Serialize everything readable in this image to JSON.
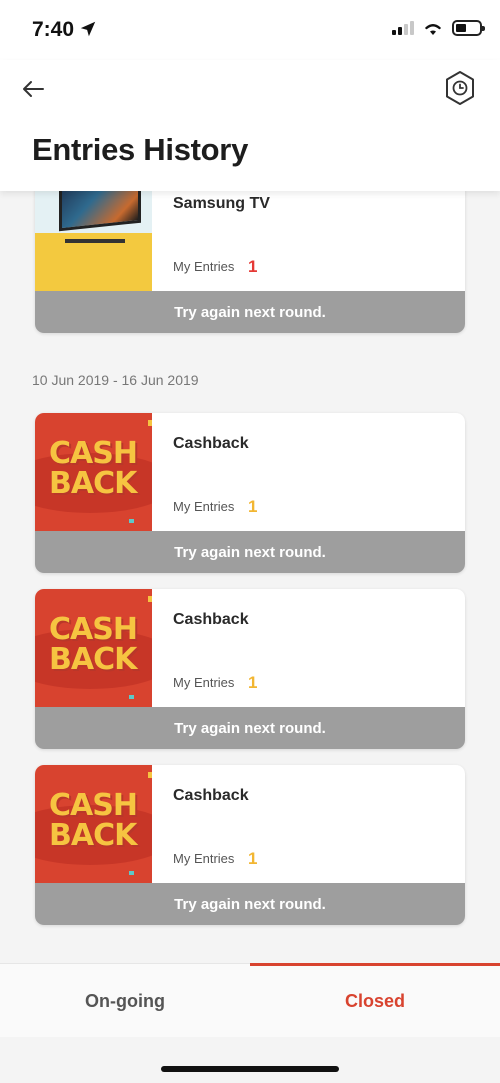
{
  "status_bar": {
    "time": "7:40"
  },
  "header": {
    "title": "Entries History"
  },
  "groups": [
    {
      "date_range": "",
      "cards": [
        {
          "title": "Samsung TV",
          "entries_label": "My Entries",
          "entries_count": "1",
          "count_color": "#e53935",
          "status": "Try again next round.",
          "image": "samsung-tv"
        }
      ]
    },
    {
      "date_range": "10 Jun 2019 - 16 Jun 2019",
      "cards": [
        {
          "title": "Cashback",
          "entries_label": "My Entries",
          "entries_count": "1",
          "count_color": "#f2b632",
          "status": "Try again next round.",
          "image": "cashback",
          "image_text": [
            "CASH",
            "BACK"
          ]
        },
        {
          "title": "Cashback",
          "entries_label": "My Entries",
          "entries_count": "1",
          "count_color": "#f2b632",
          "status": "Try again next round.",
          "image": "cashback",
          "image_text": [
            "CASH",
            "BACK"
          ]
        },
        {
          "title": "Cashback",
          "entries_label": "My Entries",
          "entries_count": "1",
          "count_color": "#f2b632",
          "status": "Try again next round.",
          "image": "cashback",
          "image_text": [
            "CASH",
            "BACK"
          ]
        }
      ]
    }
  ],
  "tabs": [
    {
      "label": "On-going",
      "active": false
    },
    {
      "label": "Closed",
      "active": true
    }
  ],
  "colors": {
    "accent": "#d8432f",
    "status_bar_bg": "#9e9e9e"
  },
  "icons": {
    "back": "arrow-left-icon",
    "history": "hexagon-clock-icon",
    "location": "location-arrow-icon"
  }
}
